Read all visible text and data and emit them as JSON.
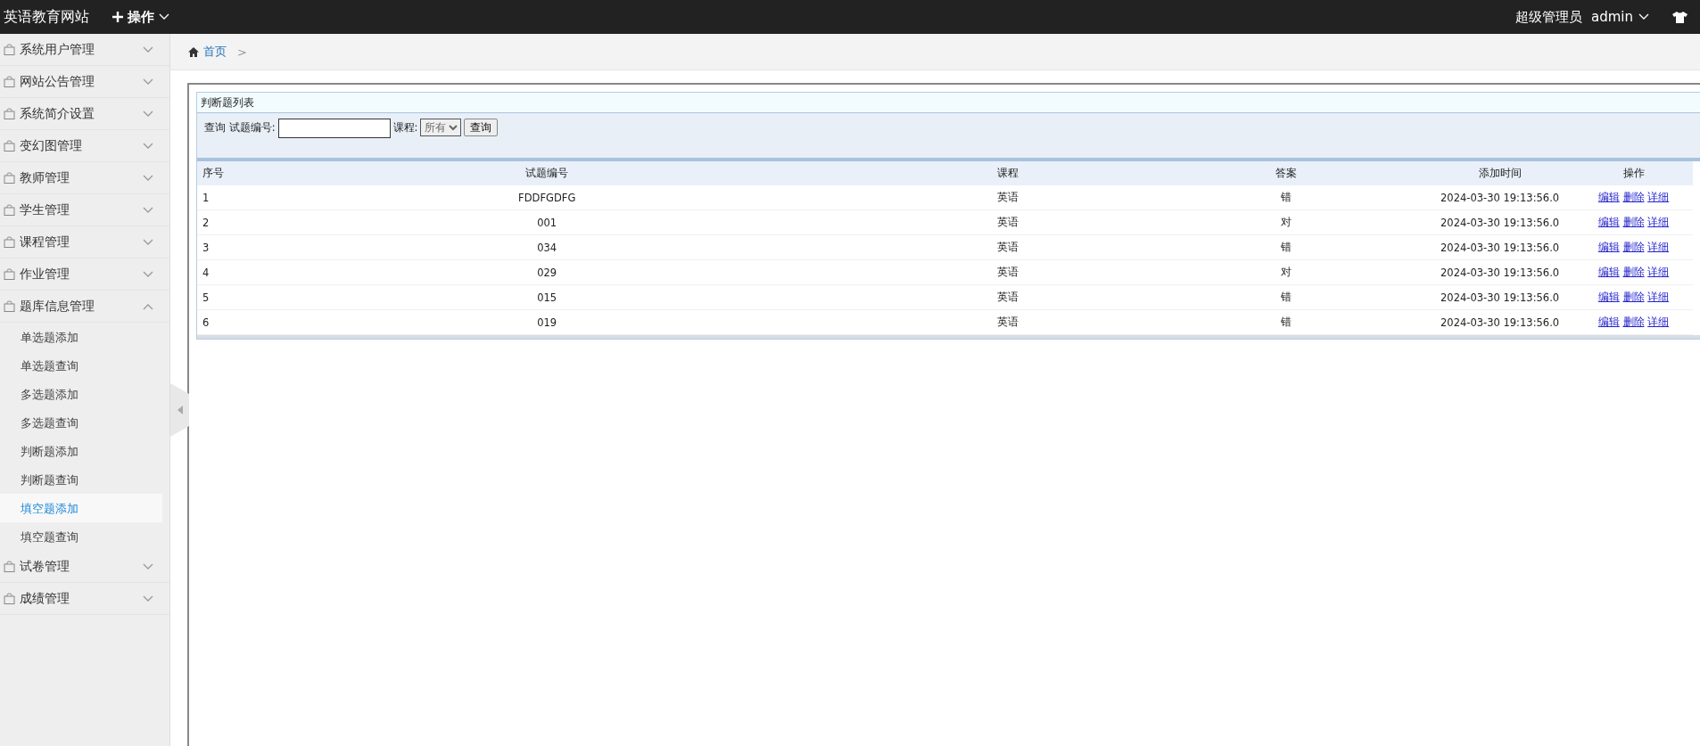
{
  "topbar": {
    "site_title": "英语教育网站",
    "menu": {
      "label": "操作"
    },
    "user": {
      "role": "超级管理员",
      "name": "admin"
    }
  },
  "sidebar": {
    "groups": [
      {
        "label": "系统用户管理",
        "expanded": false
      },
      {
        "label": "网站公告管理",
        "expanded": false
      },
      {
        "label": "系统简介设置",
        "expanded": false
      },
      {
        "label": "变幻图管理",
        "expanded": false
      },
      {
        "label": "教师管理",
        "expanded": false
      },
      {
        "label": "学生管理",
        "expanded": false
      },
      {
        "label": "课程管理",
        "expanded": false
      },
      {
        "label": "作业管理",
        "expanded": false
      },
      {
        "label": "题库信息管理",
        "expanded": true,
        "children": [
          {
            "label": "单选题添加",
            "selected": false
          },
          {
            "label": "单选题查询",
            "selected": false
          },
          {
            "label": "多选题添加",
            "selected": false
          },
          {
            "label": "多选题查询",
            "selected": false
          },
          {
            "label": "判断题添加",
            "selected": false
          },
          {
            "label": "判断题查询",
            "selected": false
          },
          {
            "label": "填空题添加",
            "selected": true
          },
          {
            "label": "填空题查询",
            "selected": false
          }
        ]
      },
      {
        "label": "试卷管理",
        "expanded": false
      },
      {
        "label": "成绩管理",
        "expanded": false
      }
    ]
  },
  "breadcrumb": {
    "home": "首页",
    "separator": ">"
  },
  "panel": {
    "title": "判断题列表",
    "search": {
      "prefix": "查询",
      "id_label": "试题编号:",
      "course_label": "课程:",
      "course_value": "所有",
      "button": "查询"
    },
    "table": {
      "columns": [
        "序号",
        "试题编号",
        "课程",
        "答案",
        "添加时间",
        "操作"
      ],
      "rows": [
        {
          "cells": [
            "1",
            "FDDFGDFG",
            "英语",
            "错",
            "2024-03-30 19:13:56.0"
          ],
          "actions": [
            "编辑",
            "删除",
            "详细"
          ]
        },
        {
          "cells": [
            "2",
            "001",
            "英语",
            "对",
            "2024-03-30 19:13:56.0"
          ],
          "actions": [
            "编辑",
            "删除",
            "详细"
          ]
        },
        {
          "cells": [
            "3",
            "034",
            "英语",
            "错",
            "2024-03-30 19:13:56.0"
          ],
          "actions": [
            "编辑",
            "删除",
            "详细"
          ]
        },
        {
          "cells": [
            "4",
            "029",
            "英语",
            "对",
            "2024-03-30 19:13:56.0"
          ],
          "actions": [
            "编辑",
            "删除",
            "详细"
          ]
        },
        {
          "cells": [
            "5",
            "015",
            "英语",
            "错",
            "2024-03-30 19:13:56.0"
          ],
          "actions": [
            "编辑",
            "删除",
            "详细"
          ]
        },
        {
          "cells": [
            "6",
            "019",
            "英语",
            "错",
            "2024-03-30 19:13:56.0"
          ],
          "actions": [
            "编辑",
            "删除",
            "详细"
          ]
        }
      ]
    }
  }
}
